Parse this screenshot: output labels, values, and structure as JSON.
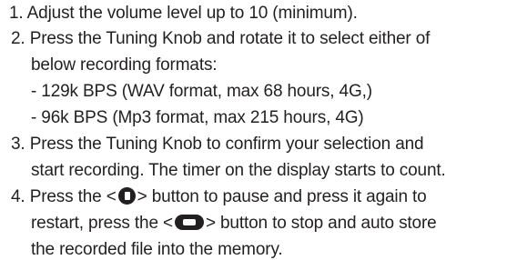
{
  "steps": [
    {
      "number": "1.",
      "lines": [
        "Adjust the volume level up to 10 (minimum)."
      ]
    },
    {
      "number": "2.",
      "lines": [
        "Press the Tuning Knob and rotate it to select either of",
        "below recording formats:",
        "- 129k BPS (WAV format, max 68 hours, 4G,)",
        "- 96k BPS (Mp3 format, max 215 hours, 4G)"
      ]
    },
    {
      "number": "3.",
      "lines": [
        "Press the Tuning Knob to confirm your selection and",
        "start recording. The timer on the display starts to count."
      ]
    },
    {
      "number": "4.",
      "line1_a": "Press the <",
      "line1_b": "> button to pause and press it again to",
      "line2_a": "restart, press the <",
      "line2_b": "> button to stop and auto store",
      "line3": "the recorded file into the memory."
    }
  ],
  "icons": {
    "pause_button_icon": "round-button-icon",
    "stop_button_icon": "pill-button-icon"
  },
  "colors": {
    "text": "#231f20",
    "background": "#ffffff"
  }
}
